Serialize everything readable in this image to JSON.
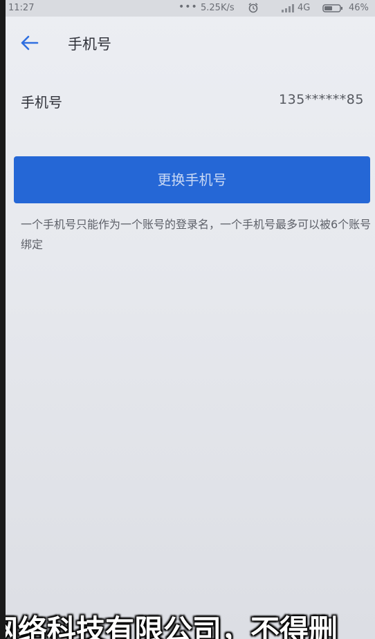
{
  "status_bar": {
    "time": "11:27",
    "dots": "•••",
    "speed": "5.25K/s",
    "network": "4G",
    "battery": "46%"
  },
  "header": {
    "title": "手机号"
  },
  "phone_row": {
    "label": "手机号",
    "value": "135******85"
  },
  "change_button": {
    "label": "更换手机号"
  },
  "note": "一个手机号只能作为一个账号的登录名，一个手机号最多可以被6个账号绑定",
  "watermark": "网络科技有限公司，不得删",
  "colors": {
    "accent": "#2567d6",
    "back_arrow": "#2f6fe0"
  }
}
